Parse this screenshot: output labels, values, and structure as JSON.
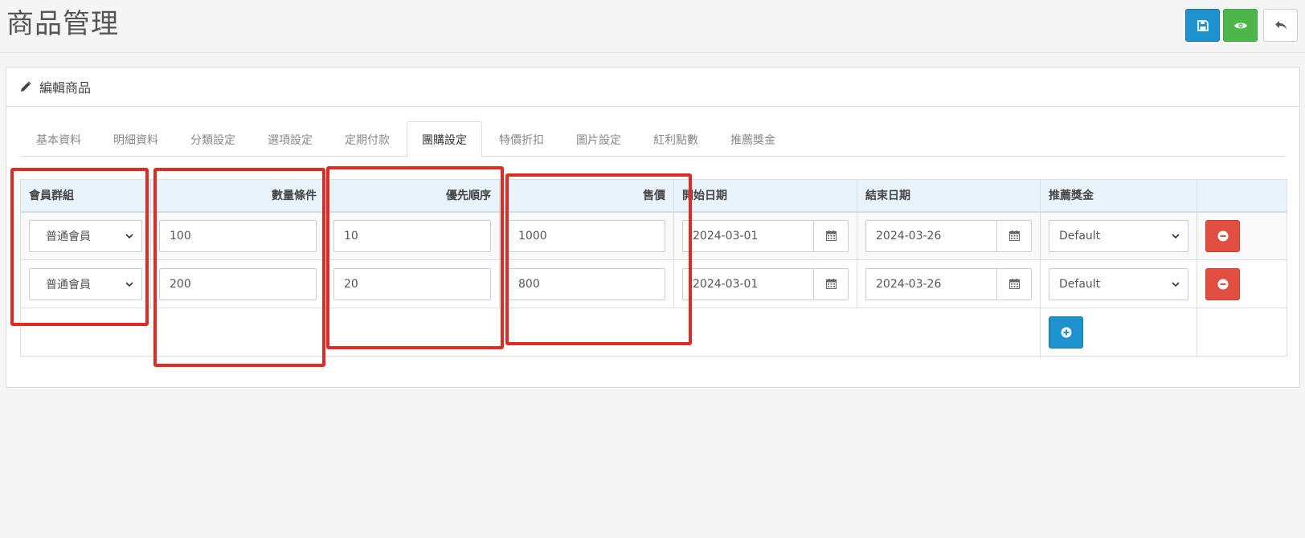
{
  "header": {
    "title": "商品管理",
    "save_icon": "floppy-disk-icon",
    "view_icon": "eye-icon",
    "back_icon": "reply-arrow-icon"
  },
  "panel": {
    "heading": "編輯商品",
    "heading_icon": "pencil-icon"
  },
  "tabs": [
    {
      "label": "基本資料"
    },
    {
      "label": "明細資料"
    },
    {
      "label": "分類設定"
    },
    {
      "label": "選項設定"
    },
    {
      "label": "定期付款"
    },
    {
      "label": "團購設定",
      "active": true
    },
    {
      "label": "特價折扣"
    },
    {
      "label": "圖片設定"
    },
    {
      "label": "紅利點數"
    },
    {
      "label": "推薦獎金"
    }
  ],
  "table": {
    "headers": {
      "group": "會員群組",
      "qty": "數量條件",
      "priority": "優先順序",
      "price": "售價",
      "start": "開始日期",
      "end": "結束日期",
      "bonus": "推薦獎金"
    },
    "rows": [
      {
        "group": "普通會員",
        "qty": "100",
        "priority": "10",
        "price": "1000",
        "start": "2024-03-01",
        "end": "2024-03-26",
        "bonus": "Default"
      },
      {
        "group": "普通會員",
        "qty": "200",
        "priority": "20",
        "price": "800",
        "start": "2024-03-01",
        "end": "2024-03-26",
        "bonus": "Default"
      }
    ]
  },
  "colors": {
    "primary": "#1e91cf",
    "success": "#4cb64c",
    "danger": "#e04f3f",
    "highlight": "#e02a24"
  }
}
